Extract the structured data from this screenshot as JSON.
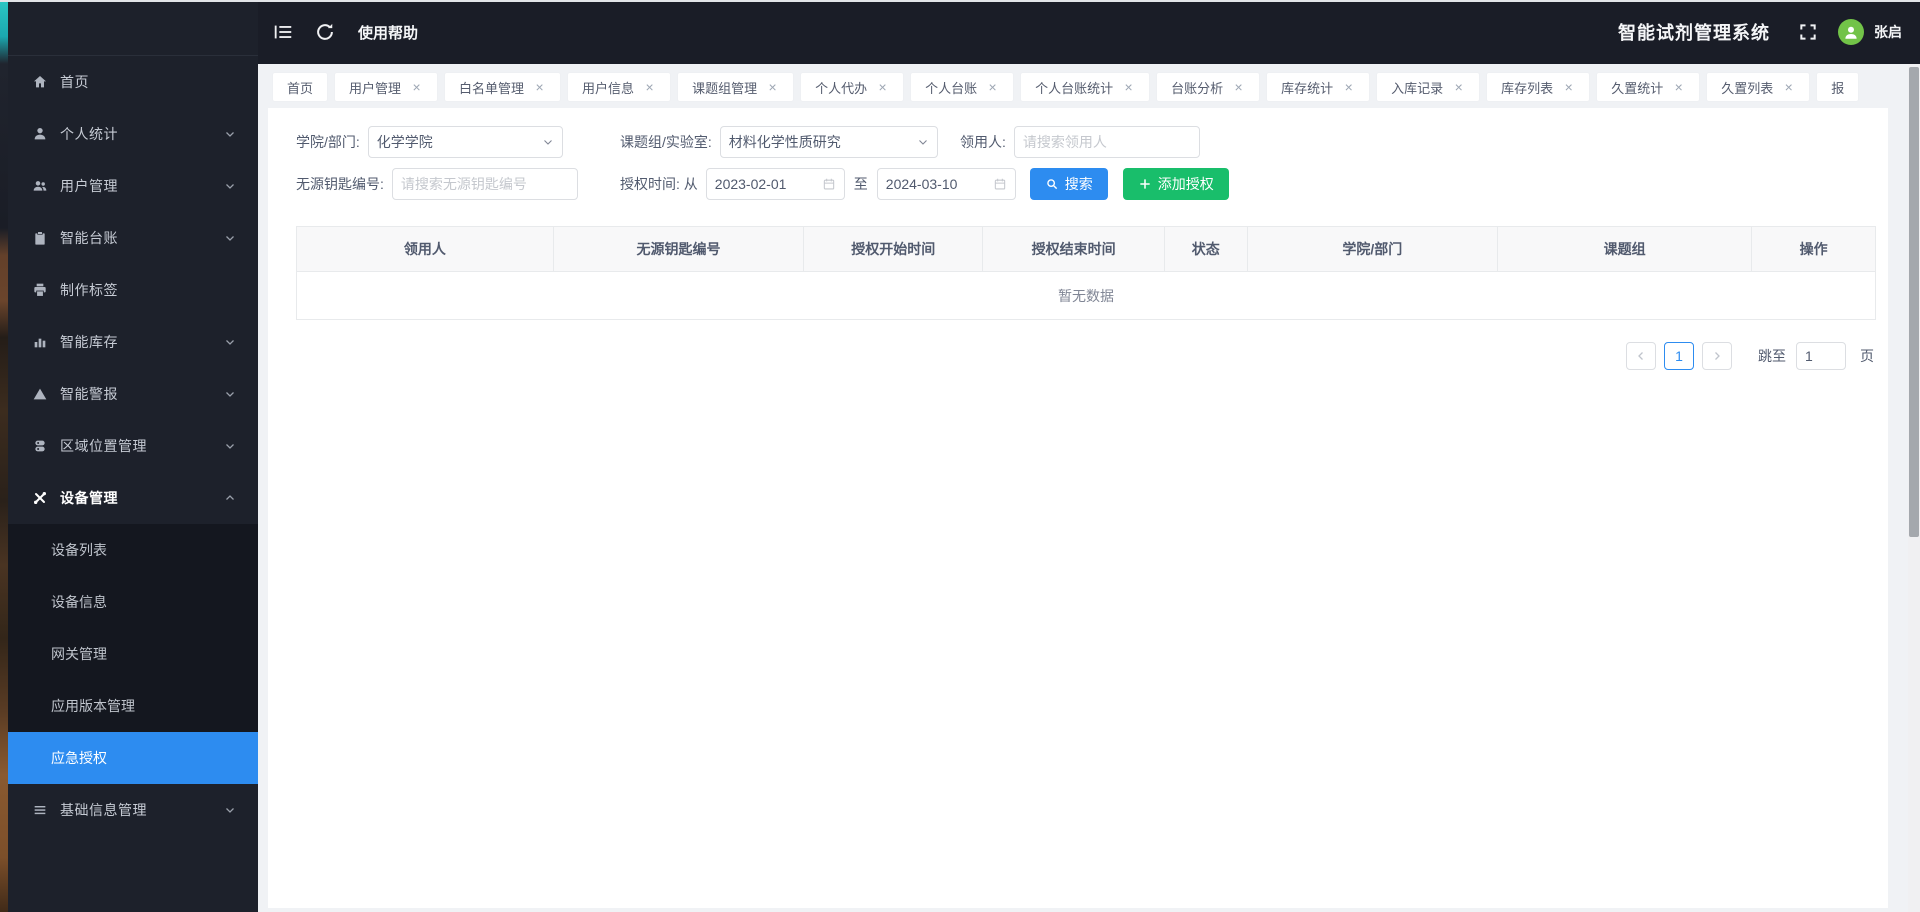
{
  "topbar": {
    "help_label": "使用帮助",
    "app_title": "智能试剂管理系统",
    "user_name": "张启"
  },
  "tabs": [
    {
      "label": "首页"
    },
    {
      "label": "用户管理"
    },
    {
      "label": "白名单管理"
    },
    {
      "label": "用户信息"
    },
    {
      "label": "课题组管理"
    },
    {
      "label": "个人代办"
    },
    {
      "label": "个人台账"
    },
    {
      "label": "个人台账统计"
    },
    {
      "label": "台账分析"
    },
    {
      "label": "库存统计"
    },
    {
      "label": "入库记录"
    },
    {
      "label": "库存列表"
    },
    {
      "label": "久置统计"
    },
    {
      "label": "久置列表"
    },
    {
      "label": "报"
    }
  ],
  "sidebar": {
    "items": [
      {
        "label": "首页",
        "icon": "home-icon"
      },
      {
        "label": "个人统计",
        "icon": "user-icon"
      },
      {
        "label": "用户管理",
        "icon": "users-icon"
      },
      {
        "label": "智能台账",
        "icon": "clipboard-icon"
      },
      {
        "label": "制作标签",
        "icon": "printer-icon"
      },
      {
        "label": "智能库存",
        "icon": "bar-chart-icon"
      },
      {
        "label": "智能警报",
        "icon": "alert-triangle-icon"
      },
      {
        "label": "区域位置管理",
        "icon": "region-icon"
      },
      {
        "label": "设备管理",
        "icon": "tools-icon"
      },
      {
        "label": "基础信息管理",
        "icon": "list-icon"
      }
    ],
    "submenu": [
      {
        "label": "设备列表"
      },
      {
        "label": "设备信息"
      },
      {
        "label": "网关管理"
      },
      {
        "label": "应用版本管理"
      },
      {
        "label": "应急授权"
      }
    ],
    "active_parent": "设备管理",
    "active_submenu": "应急授权"
  },
  "filters": {
    "dept_label": "学院/部门:",
    "dept_value": "化学学院",
    "group_label": "课题组/实验室:",
    "group_value": "材料化学性质研究",
    "recipient_label": "领用人:",
    "recipient_placeholder": "请搜索领用人",
    "key_label": "无源钥匙编号:",
    "key_placeholder": "请搜索无源钥匙编号",
    "time_label": "授权时间: 从",
    "to_label": "至",
    "from_value": "2023-02-01",
    "to_value": "2024-03-10",
    "search_label": "搜索",
    "add_label": "添加授权"
  },
  "table": {
    "columns": [
      "领用人",
      "无源钥匙编号",
      "授权开始时间",
      "授权结束时间",
      "状态",
      "学院/部门",
      "课题组",
      "操作"
    ],
    "empty_text": "暂无数据"
  },
  "pagination": {
    "current_page": "1",
    "jump_label": "跳至",
    "jump_value": "1",
    "page_unit_label": "页"
  },
  "colors": {
    "accent_blue": "#2d8cf0",
    "success_green": "#19be6b",
    "avatar_green": "#72c348",
    "sidebar_bg": "#1d212b",
    "submenu_bg": "#14171f",
    "topbar_bg": "#1a1d27"
  }
}
